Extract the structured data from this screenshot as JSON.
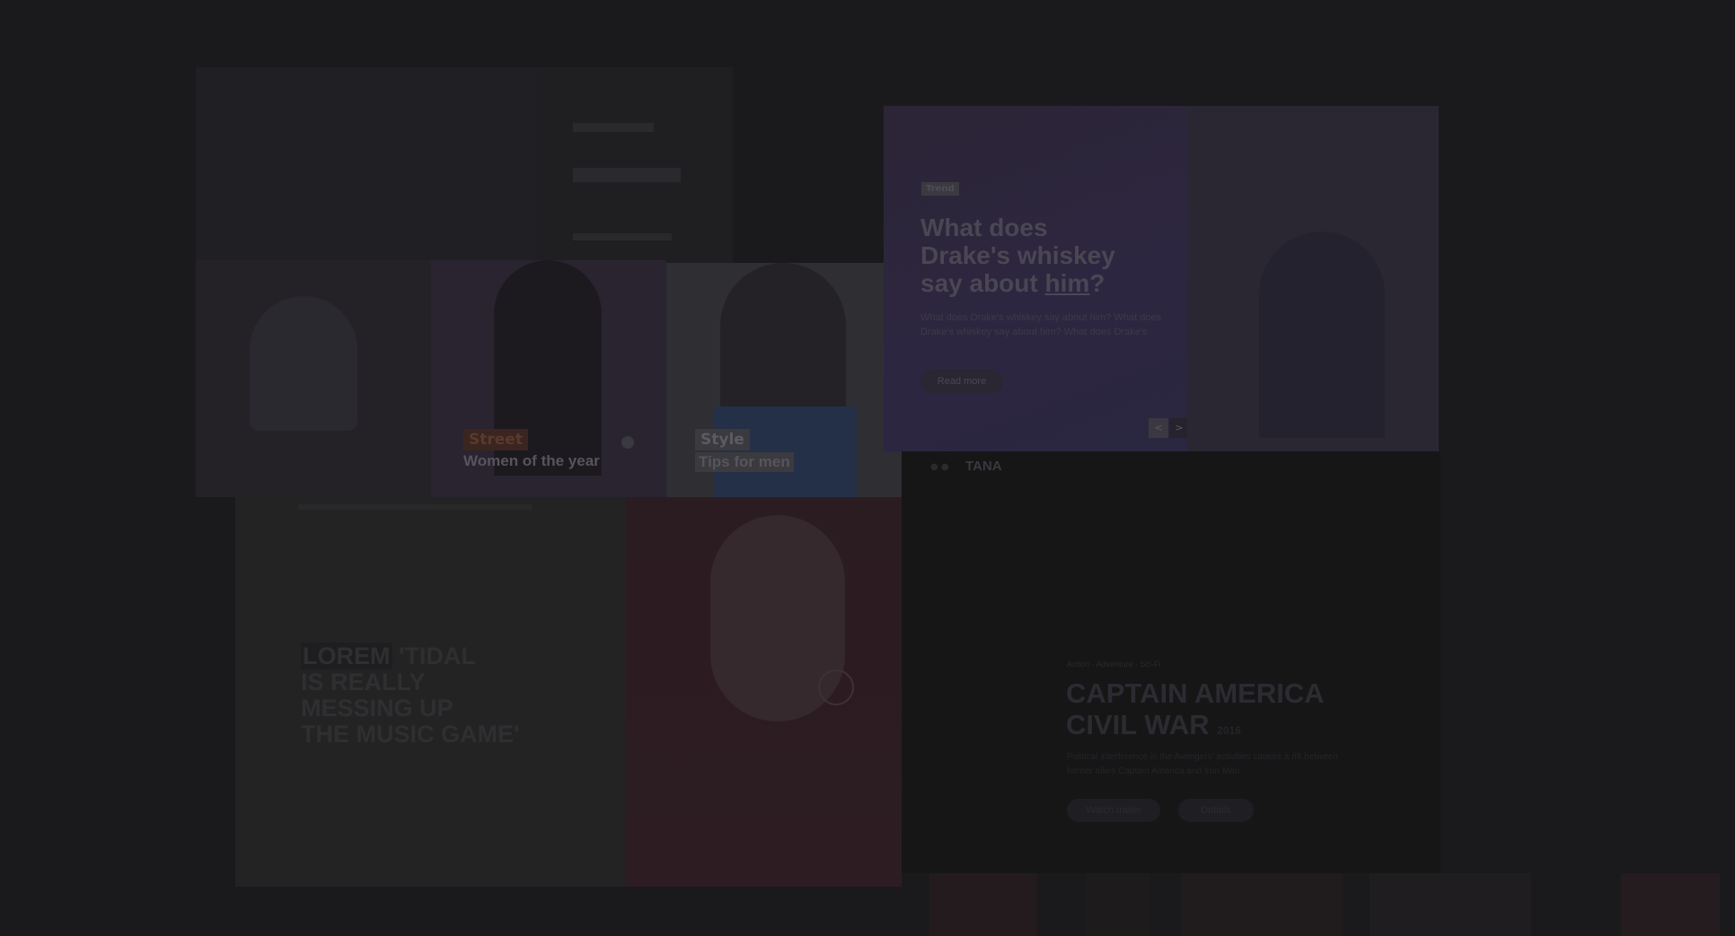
{
  "slider": {
    "tag": "Trend",
    "headline_line1": "What does",
    "headline_line2": "Drake's whiskey",
    "headline_line3_pre": "say about ",
    "headline_line3_emph": "him",
    "headline_line3_post": "?",
    "excerpt_line1": "What does Drake's whiskey say about him? What does",
    "excerpt_line2": "Drake's whiskey say about him? What does Drake's",
    "cta": "Read more",
    "prev": "<",
    "next": ">"
  },
  "cards": [
    {
      "category": "Street",
      "title": "Women of the year"
    },
    {
      "category": "Style",
      "title": "Tips for men"
    }
  ],
  "poster": {
    "headline_line1_hl": "LOREM",
    "headline_line1_rest": "'TIDAL",
    "headline_line2": "IS REALLY",
    "headline_line3": "MESSING UP",
    "headline_line4": "THE MUSIC GAME'"
  },
  "hero": {
    "brand": "TANA",
    "meta": "Action · Adventure · Sci-Fi",
    "title_line1": "CAPTAIN AMERICA",
    "title_line2": "CIVIL WAR",
    "title_suffix": "2016",
    "desc_line1": "Political interference in the Avengers' activities causes a rift between",
    "desc_line2": "former allies Captain America and Iron Man.",
    "btn_primary": "Watch trailer",
    "btn_secondary": "Details"
  },
  "colors": {
    "background": "#1a1a1c",
    "slider": "#2c2638",
    "street_tag": "#3a2520"
  }
}
